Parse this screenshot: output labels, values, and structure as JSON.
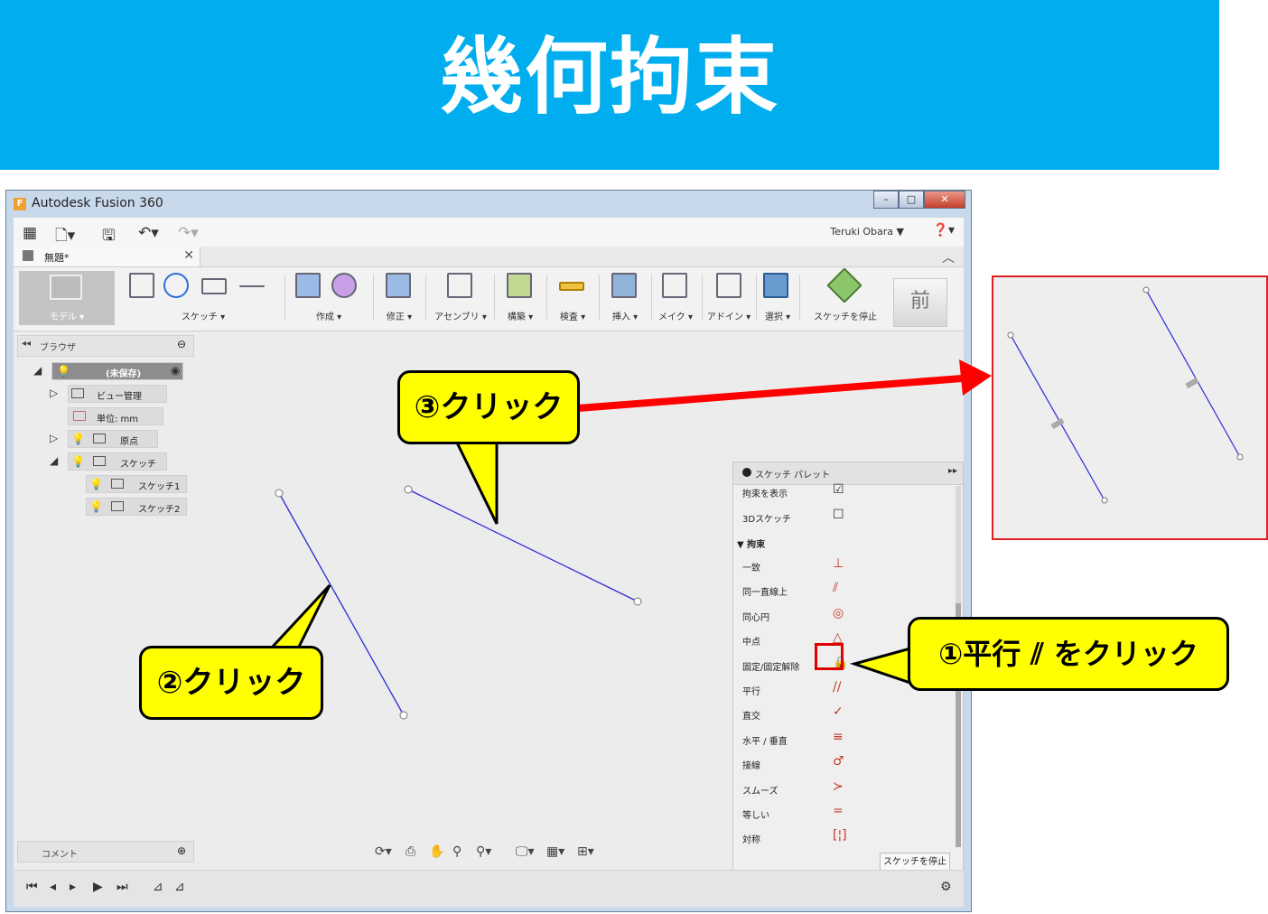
{
  "banner": {
    "title": "幾何拘束",
    "bg": "#00aeef"
  },
  "window": {
    "title": "Autodesk Fusion 360",
    "user": "Teruki Obara ▼",
    "doc_tab": "無題*"
  },
  "toolbar": {
    "model": "モデル ▾",
    "groups": [
      "スケッチ ▾",
      "作成 ▾",
      "修正 ▾",
      "アセンブリ ▾",
      "構築 ▾",
      "検査 ▾",
      "挿入 ▾",
      "メイク ▾",
      "アドイン ▾",
      "選択 ▾",
      "スケッチを停止"
    ],
    "mae": "前"
  },
  "browser": {
    "title": "ブラウザ",
    "items": [
      {
        "label": "(未保存)"
      },
      {
        "label": "ビュー管理"
      },
      {
        "label": "単位: mm"
      },
      {
        "label": "原点"
      },
      {
        "label": "スケッチ"
      },
      {
        "label": "スケッチ1"
      },
      {
        "label": "スケッチ2"
      }
    ]
  },
  "palette": {
    "title": "スケッチ パレット",
    "options": [
      {
        "label": "拘束を表示",
        "checked": true
      },
      {
        "label": "3Dスケッチ",
        "checked": false
      }
    ],
    "section": "拘束",
    "constraints": [
      {
        "label": "一致",
        "icon": "coincident-icon",
        "glyph": "⊥"
      },
      {
        "label": "同一直線上",
        "icon": "collinear-icon",
        "glyph": "⫽"
      },
      {
        "label": "同心円",
        "icon": "concentric-icon",
        "glyph": "◎"
      },
      {
        "label": "中点",
        "icon": "midpoint-icon",
        "glyph": "△"
      },
      {
        "label": "固定/固定解除",
        "icon": "lock-icon",
        "glyph": "🔒"
      },
      {
        "label": "平行",
        "icon": "parallel-icon",
        "glyph": "//"
      },
      {
        "label": "直交",
        "icon": "perpendicular-icon",
        "glyph": "✓"
      },
      {
        "label": "水平 / 垂直",
        "icon": "horizontal-vertical-icon",
        "glyph": "≡"
      },
      {
        "label": "接線",
        "icon": "tangent-icon",
        "glyph": "♂"
      },
      {
        "label": "スムーズ",
        "icon": "smooth-icon",
        "glyph": "≻"
      },
      {
        "label": "等しい",
        "icon": "equal-icon",
        "glyph": "="
      },
      {
        "label": "対称",
        "icon": "symmetry-icon",
        "glyph": "[¦]"
      }
    ],
    "stop_button": "スケッチを停止"
  },
  "comment": {
    "label": "コメント"
  },
  "callouts": {
    "c1": "①平行 ⫽ をクリック",
    "c2": "②クリック",
    "c3": "③クリック"
  },
  "colors": {
    "callout": "#ffff00",
    "arrow": "#ff0000",
    "sketch_line": "#2b2bd6"
  }
}
